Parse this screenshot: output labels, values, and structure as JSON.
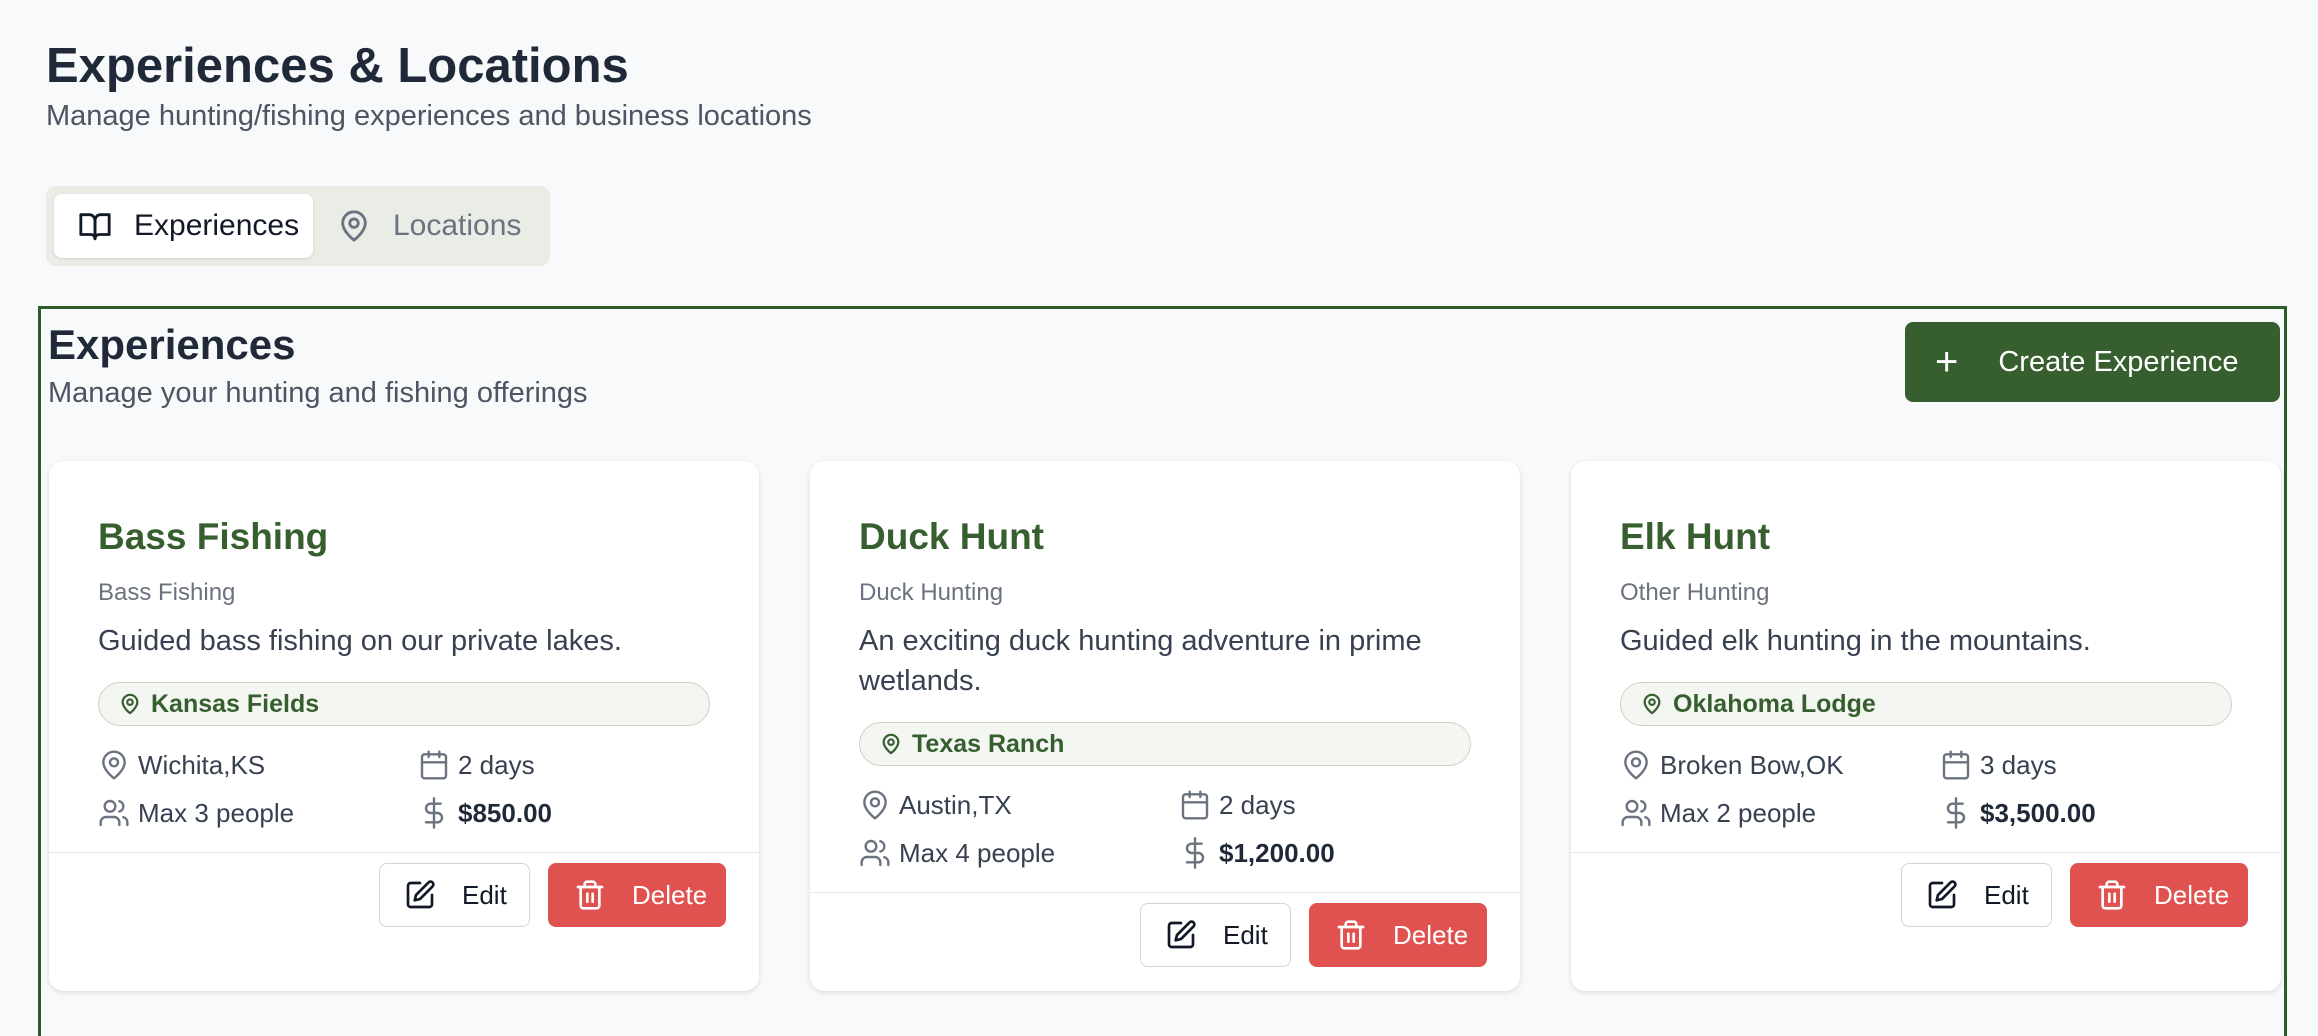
{
  "header": {
    "title": "Experiences & Locations",
    "subtitle": "Manage hunting/fishing experiences and business locations"
  },
  "tabs": [
    {
      "label": "Experiences",
      "icon": "book-open-icon",
      "active": true
    },
    {
      "label": "Locations",
      "icon": "map-pin-icon",
      "active": false
    }
  ],
  "section": {
    "title": "Experiences",
    "subtitle": "Manage your hunting and fishing offerings",
    "create_label": "Create Experience"
  },
  "colors": {
    "brand_green": "#365e2f",
    "delete_red": "#e0524f",
    "badge_bg": "#f3f6f1"
  },
  "cards": [
    {
      "title": "Bass Fishing",
      "type": "Bass Fishing",
      "description": "Guided bass fishing on our private lakes.",
      "location_badge": "Kansas Fields",
      "city": "Wichita,KS",
      "duration": "2 days",
      "capacity": "Max 3 people",
      "price": "$850.00",
      "edit_label": "Edit",
      "delete_label": "Delete"
    },
    {
      "title": "Duck Hunt",
      "type": "Duck Hunting",
      "description": "An exciting duck hunting adventure in prime wetlands.",
      "location_badge": "Texas Ranch",
      "city": "Austin,TX",
      "duration": "2 days",
      "capacity": "Max 4 people",
      "price": "$1,200.00",
      "edit_label": "Edit",
      "delete_label": "Delete"
    },
    {
      "title": "Elk Hunt",
      "type": "Other Hunting",
      "description": "Guided elk hunting in the mountains.",
      "location_badge": "Oklahoma Lodge",
      "city": "Broken Bow,OK",
      "duration": "3 days",
      "capacity": "Max 2 people",
      "price": "$3,500.00",
      "edit_label": "Edit",
      "delete_label": "Delete"
    }
  ]
}
